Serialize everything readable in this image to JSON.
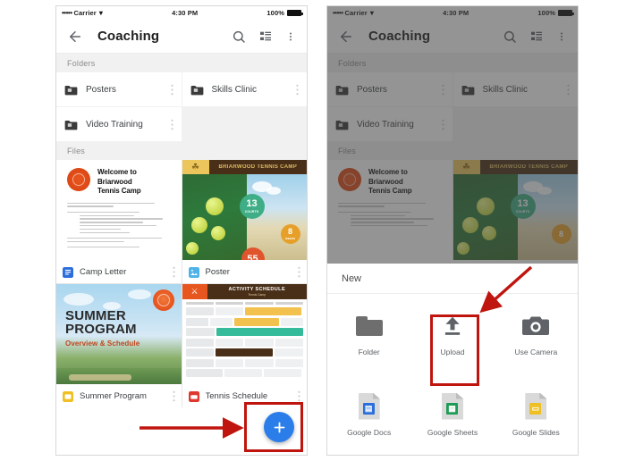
{
  "status_bar": {
    "signal_dots": "•••••",
    "carrier": "Carrier",
    "wifi_icon": "wifi-icon",
    "time": "4:30 PM",
    "battery_pct": "100%"
  },
  "app_bar": {
    "back_icon": "back-arrow-icon",
    "title": "Coaching",
    "search_icon": "search-icon",
    "view_toggle_icon": "list-view-icon",
    "overflow_icon": "more-vert-icon"
  },
  "sections": {
    "folders_label": "Folders",
    "files_label": "Files"
  },
  "folders": [
    {
      "name": "Posters",
      "icon": "folder-icon",
      "menu_icon": "more-vert-icon"
    },
    {
      "name": "Skills Clinic",
      "icon": "folder-icon",
      "menu_icon": "more-vert-icon"
    },
    {
      "name": "Video Training",
      "icon": "folder-icon",
      "menu_icon": "more-vert-icon"
    }
  ],
  "files": [
    {
      "name": "Camp Letter",
      "icon": "google-docs-icon",
      "icon_color": "#2b6edb",
      "menu_icon": "more-vert-icon"
    },
    {
      "name": "Poster",
      "icon": "image-file-icon",
      "icon_color": "#4fb3e8",
      "menu_icon": "more-vert-icon"
    },
    {
      "name": "Summer Program",
      "icon": "google-slides-icon",
      "icon_color": "#efc024",
      "menu_icon": "more-vert-icon"
    },
    {
      "name": "Tennis Schedule",
      "icon": "pdf-file-icon",
      "icon_color": "#e0382c",
      "menu_icon": "more-vert-icon"
    }
  ],
  "thumbnails": {
    "camp_letter": {
      "title_lines": [
        "Welcome to",
        "Briarwood",
        "Tennis Camp"
      ],
      "seal": "circular-seal-graphic"
    },
    "poster": {
      "banner_text": "BRIARWOOD TENNIS CAMP",
      "badges": [
        {
          "number": "13",
          "caption": "COURTS"
        },
        {
          "number": "8",
          "caption": "WEEKS"
        },
        {
          "number": "55",
          "caption": ""
        }
      ]
    },
    "summer_program": {
      "line1": "SUMMER",
      "line2": "PROGRAM",
      "line3": "Overview & Schedule"
    },
    "tennis_schedule": {
      "header_title": "ACTIVITY SCHEDULE",
      "header_sub": "Tennis Camp",
      "logo": "crossed-rackets-icon"
    }
  },
  "fab": {
    "label": "Create new",
    "icon": "plus-icon",
    "color": "#2b7de9"
  },
  "bottom_sheet": {
    "header": "New",
    "items": [
      {
        "label": "Folder",
        "icon": "folder-icon"
      },
      {
        "label": "Upload",
        "icon": "upload-icon"
      },
      {
        "label": "Use Camera",
        "icon": "camera-icon"
      },
      {
        "label": "Google Docs",
        "icon": "google-docs-icon",
        "glyph": "▤"
      },
      {
        "label": "Google Sheets",
        "icon": "google-sheets-icon",
        "glyph": "▦"
      },
      {
        "label": "Google Slides",
        "icon": "google-slides-icon",
        "glyph": "▭"
      }
    ]
  },
  "annotations": {
    "highlight_color": "#c0150f",
    "fab_highlight": "red-box-around-fab",
    "fab_arrow": "red-arrow-pointing-right-to-fab",
    "upload_highlight": "red-box-around-upload",
    "upload_arrow": "red-arrow-pointing-down-left-to-upload"
  }
}
